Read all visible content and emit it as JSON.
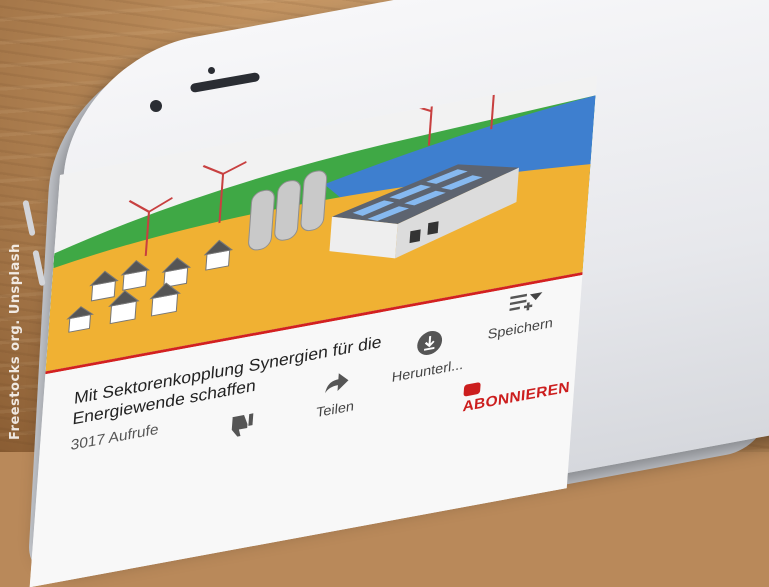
{
  "photo_credit": "Freestocks org. Unsplash",
  "video": {
    "title": "Mit Sektorenkopplung Synergien für die Energiewende schaffen",
    "views": "3017 Aufrufe"
  },
  "actions": {
    "share": "Teilen",
    "download": "Herunterl...",
    "save": "Speichern"
  },
  "subscribe_label": "ABONNIEREN",
  "colors": {
    "accent_red": "#cc1e1e",
    "ground_orange": "#f0b133",
    "field_green": "#3fa845",
    "field_blue": "#3e7fcf"
  }
}
